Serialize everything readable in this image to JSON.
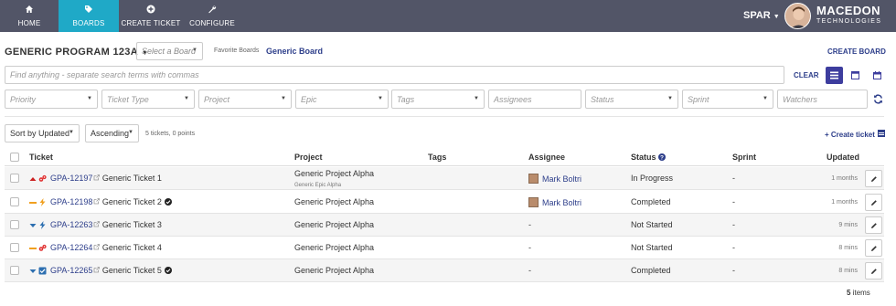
{
  "nav": {
    "tabs": [
      {
        "label": "HOME",
        "icon": "home-icon"
      },
      {
        "label": "BOARDS",
        "icon": "tag-icon",
        "active": true
      },
      {
        "label": "CREATE TICKET",
        "icon": "plus-circle-icon"
      },
      {
        "label": "CONFIGURE",
        "icon": "wrench-icon"
      }
    ],
    "user": "SPAR",
    "brand_line1": "MACEDON",
    "brand_line2": "TECHNOLOGIES"
  },
  "toolbar": {
    "program_title": "GENERIC PROGRAM 123A",
    "board_select_placeholder": "Select a Board",
    "favorite_label": "Favorite Boards",
    "favorite_board": "Generic Board",
    "create_board": "CREATE BOARD"
  },
  "search": {
    "placeholder": "Find anything - separate search terms with commas",
    "clear": "CLEAR"
  },
  "filters": [
    "Priority",
    "Ticket Type",
    "Project",
    "Epic",
    "Tags",
    "Assignees",
    "Status",
    "Sprint",
    "Watchers"
  ],
  "sort": {
    "field": "Sort by Updated",
    "order": "Ascending",
    "count": "5 tickets, 0 points",
    "create_ticket": "+ Create ticket"
  },
  "table": {
    "headers": {
      "ticket": "Ticket",
      "project": "Project",
      "tags": "Tags",
      "assignee": "Assignee",
      "status": "Status",
      "sprint": "Sprint",
      "updated": "Updated"
    },
    "rows": [
      {
        "key": "GPA-12197",
        "name": "Generic Ticket 1",
        "project": "Generic Project Alpha",
        "epic": "Generic Epic Alpha",
        "assignee": "Mark Boltri",
        "status": "In Progress",
        "sprint": "-",
        "updated": "1 months",
        "priority": "high",
        "type": "bug",
        "done": false
      },
      {
        "key": "GPA-12198",
        "name": "Generic Ticket 2",
        "project": "Generic Project Alpha",
        "epic": "",
        "assignee": "Mark Boltri",
        "status": "Completed",
        "sprint": "-",
        "updated": "1 months",
        "priority": "medium",
        "type": "improvement",
        "done": true
      },
      {
        "key": "GPA-12263",
        "name": "Generic Ticket 3",
        "project": "Generic Project Alpha",
        "epic": "",
        "assignee": "-",
        "status": "Not Started",
        "sprint": "-",
        "updated": "9 mins",
        "priority": "low",
        "type": "improvement",
        "done": false
      },
      {
        "key": "GPA-12264",
        "name": "Generic Ticket 4",
        "project": "Generic Project Alpha",
        "epic": "",
        "assignee": "-",
        "status": "Not Started",
        "sprint": "-",
        "updated": "8 mins",
        "priority": "medium",
        "type": "bug",
        "done": false
      },
      {
        "key": "GPA-12265",
        "name": "Generic Ticket 5",
        "project": "Generic Project Alpha",
        "epic": "",
        "assignee": "-",
        "status": "Completed",
        "sprint": "-",
        "updated": "8 mins",
        "priority": "low",
        "type": "task",
        "done": true
      }
    ]
  },
  "footer": {
    "count": "5",
    "label": "items"
  },
  "colors": {
    "nav_bg": "#525567",
    "active_tab": "#1fa9c7",
    "link": "#2d3e8a",
    "priority_high": "#cc2222",
    "priority_medium": "#f0a020",
    "priority_low": "#2d6fb0"
  }
}
